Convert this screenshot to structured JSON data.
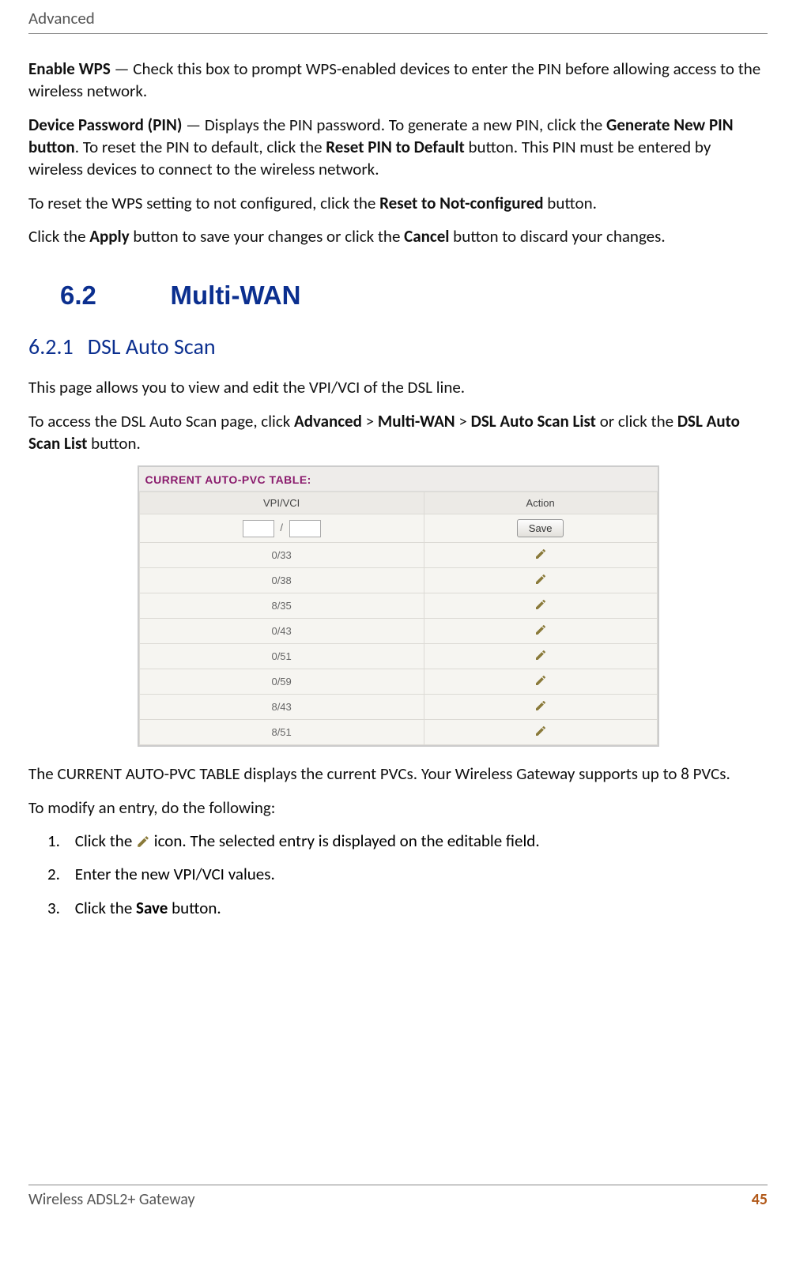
{
  "header": {
    "title": "Advanced"
  },
  "para1": {
    "bold": "Enable WPS",
    "text": " — Check this box to prompt WPS-enabled devices to enter the PIN before allowing access to the wireless network."
  },
  "para2": {
    "bold1": "Device Password (PIN)",
    "t1": " — Displays the PIN password. To generate a new PIN, click the ",
    "bold2": "Generate New PIN button",
    "t2": ". To reset the PIN to default, click the ",
    "bold3": "Reset PIN to Default",
    "t3": " button. This PIN must be entered by wireless devices to connect to the wireless network."
  },
  "para3": {
    "t1": "To reset the WPS setting to not configured, click the ",
    "bold": "Reset to Not-configured",
    "t2": " button."
  },
  "para4": {
    "t1": "Click the ",
    "bold1": "Apply",
    "t2": " button to save your changes or click the ",
    "bold2": "Cancel",
    "t3": " button to discard your changes."
  },
  "section": {
    "num": "6.2",
    "title": "Multi-WAN"
  },
  "subsection": {
    "num": "6.2.1",
    "title": "DSL Auto Scan"
  },
  "sub_p1": "This page allows you to view and edit the VPI/VCI of the DSL line.",
  "sub_p2": {
    "t1": "To access the DSL Auto Scan page, click ",
    "b1": "Advanced",
    "gt1": " > ",
    "b2": "Multi-WAN",
    "gt2": " > ",
    "b3": "DSL Auto Scan List",
    "t2": " or click the ",
    "b4": "DSL Auto Scan List",
    "t3": " button."
  },
  "pvc": {
    "title": "CURRENT AUTO-PVC TABLE:",
    "col1": "VPI/VCI",
    "col2": "Action",
    "save": "Save",
    "rows": [
      "0/33",
      "0/38",
      "8/35",
      "0/43",
      "0/51",
      "0/59",
      "8/43",
      "8/51"
    ]
  },
  "after1": "The CURRENT AUTO-PVC TABLE displays the current PVCs. Your Wireless Gateway supports up to 8 PVCs.",
  "after2": "To modify an entry, do the following:",
  "steps": {
    "s1a": "Click the ",
    "s1b": " icon. The selected entry is displayed on the editable field.",
    "s2": "Enter the new VPI/VCI values.",
    "s3a": "Click the ",
    "s3bold": "Save",
    "s3b": " button."
  },
  "footer": {
    "left": "Wireless ADSL2+ Gateway",
    "page": "45"
  }
}
